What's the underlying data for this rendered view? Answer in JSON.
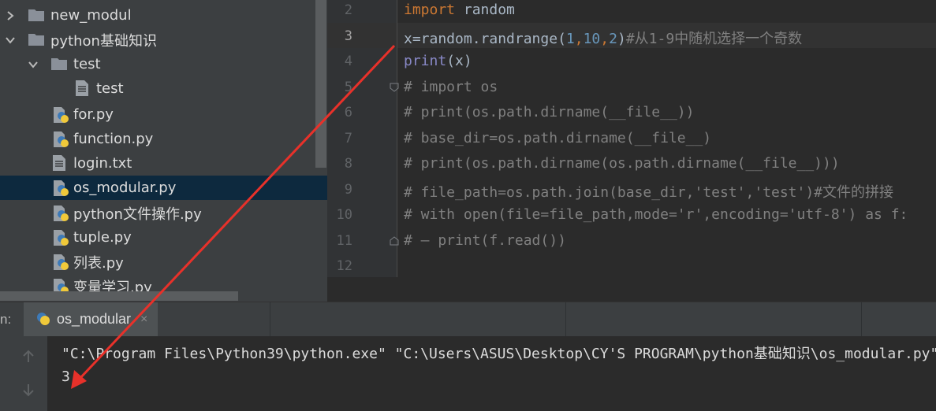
{
  "project_tree": {
    "items": [
      {
        "label": "new_modul",
        "icon": "folder-icon",
        "expanded": false
      },
      {
        "label": "python基础知识",
        "icon": "folder-icon",
        "expanded": true
      },
      {
        "label": "test",
        "icon": "folder-icon",
        "expanded": true
      },
      {
        "label": "test",
        "icon": "text-file-icon"
      },
      {
        "label": "for.py",
        "icon": "python-file-icon"
      },
      {
        "label": "function.py",
        "icon": "python-file-icon"
      },
      {
        "label": "login.txt",
        "icon": "text-file-icon"
      },
      {
        "label": "os_modular.py",
        "icon": "python-file-icon",
        "selected": true
      },
      {
        "label": "python文件操作.py",
        "icon": "python-file-icon"
      },
      {
        "label": "tuple.py",
        "icon": "python-file-icon"
      },
      {
        "label": "列表.py",
        "icon": "python-file-icon"
      },
      {
        "label": "变量学习.py",
        "icon": "python-file-icon"
      }
    ]
  },
  "editor": {
    "current_line": "3",
    "line_numbers": [
      "2",
      "3",
      "4",
      "5",
      "6",
      "7",
      "8",
      "9",
      "10",
      "11",
      "12"
    ],
    "lines": {
      "l2": {
        "kw": "import",
        "rest": " random"
      },
      "l3": {
        "a": "x=random.randrange(",
        "n1": "1",
        "c1": ",",
        "n2": "10",
        "c2": ",",
        "n3": "2",
        "b": ")",
        "cm": "#从1-9中随机选择一个奇数"
      },
      "l4": {
        "bi": "print",
        "rest": "(x)"
      },
      "l5": "# import os",
      "l6": "# print(os.path.dirname(__file__))",
      "l7": "# base_dir=os.path.dirname(__file__)",
      "l8": "# print(os.path.dirname(os.path.dirname(__file__)))",
      "l9": "# file_path=os.path.join(base_dir,'test','test')#文件的拼接",
      "l10": "# with open(file=file_path,mode='r',encoding='utf-8') as f:",
      "l11": "# — print(f.read())"
    }
  },
  "run_panel": {
    "label": "n:",
    "tab_label": "os_modular",
    "close_glyph": "×"
  },
  "console": {
    "command": "\"C:\\Program Files\\Python39\\python.exe\" \"C:\\Users\\ASUS\\Desktop\\CY'S PROGRAM\\python基础知识\\os_modular.py\"",
    "output": "3"
  },
  "colors": {
    "annotation_arrow": "#e8312a",
    "keyword": "#cc7832",
    "number": "#6897bb",
    "comment": "#808080",
    "builtin": "#8888c6",
    "selection": "#0d293e"
  }
}
